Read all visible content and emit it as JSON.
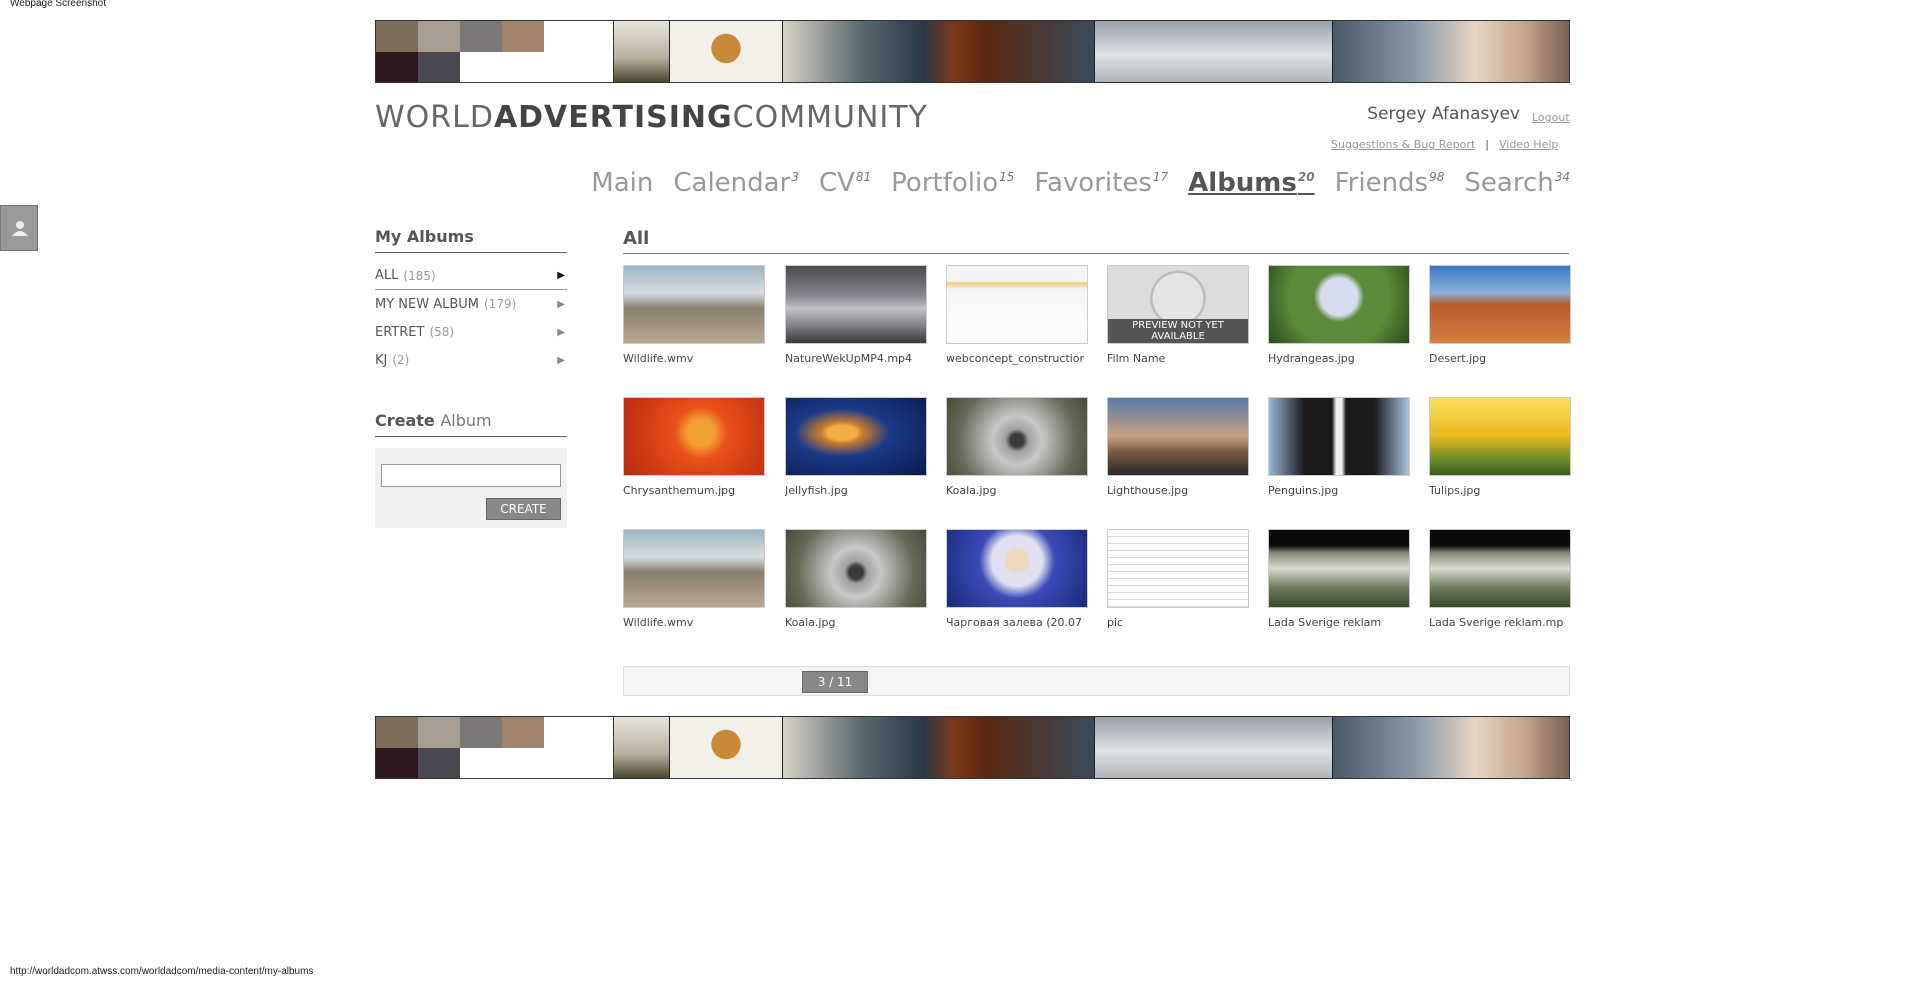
{
  "screenshot_caption": "Webpage Screenshot",
  "status_url": "http://worldadcom.atwss.com/worldadcom/media-content/my-albums",
  "logo": {
    "part1": "WORLD",
    "part2": "ADVERTISING",
    "part3": "COMMUNITY"
  },
  "user": {
    "name": "Sergey Afanasyev",
    "logout": "Logout"
  },
  "help": {
    "suggestions": "Suggestions & Bug Report",
    "separator": "|",
    "video_help": "Video Help"
  },
  "nav": [
    {
      "label": "Main",
      "count": ""
    },
    {
      "label": "Calendar",
      "count": "3"
    },
    {
      "label": "CV",
      "count": "81"
    },
    {
      "label": "Portfolio",
      "count": "15"
    },
    {
      "label": "Favorites",
      "count": "17"
    },
    {
      "label": "Albums",
      "count": "20"
    },
    {
      "label": "Friends",
      "count": "98"
    },
    {
      "label": "Search",
      "count": "34"
    }
  ],
  "sidebar": {
    "my_albums_title": "My Albums",
    "albums": [
      {
        "name": "ALL",
        "count": "(185)"
      },
      {
        "name": "MY NEW ALBUM",
        "count": "(179)"
      },
      {
        "name": "ERTRET",
        "count": "(58)"
      },
      {
        "name": "KJ",
        "count": "(2)"
      }
    ],
    "create_title_bold": "Create",
    "create_title_light": "Album",
    "create_input_value": "",
    "create_button": "CREATE"
  },
  "main": {
    "title": "All",
    "preview_label": "PREVIEW NOT YET AVAILABLE",
    "items": [
      {
        "caption": "Wildlife.wmv",
        "thumb": "beach-horses"
      },
      {
        "caption": "NatureWekUpMP4.mp4",
        "thumb": "cloudy-lake"
      },
      {
        "caption": "webconcept_constructior",
        "thumb": "web-page"
      },
      {
        "caption": "Film Name",
        "thumb": "film-countdown"
      },
      {
        "caption": "Hydrangeas.jpg",
        "thumb": "hydrangeas"
      },
      {
        "caption": "Desert.jpg",
        "thumb": "desert"
      },
      {
        "caption": "Chrysanthemum.jpg",
        "thumb": "chrysanthemum"
      },
      {
        "caption": "Jellyfish.jpg",
        "thumb": "jellyfish"
      },
      {
        "caption": "Koala.jpg",
        "thumb": "koala"
      },
      {
        "caption": "Lighthouse.jpg",
        "thumb": "lighthouse"
      },
      {
        "caption": "Penguins.jpg",
        "thumb": "penguins"
      },
      {
        "caption": "Tulips.jpg",
        "thumb": "tulips"
      },
      {
        "caption": "Wildlife.wmv",
        "thumb": "beach-horses"
      },
      {
        "caption": "Koala.jpg",
        "thumb": "koala"
      },
      {
        "caption": "Чарговая залева (20.07",
        "thumb": "news-presenter"
      },
      {
        "caption": "pic",
        "thumb": "document"
      },
      {
        "caption": "Lada Sverige reklam",
        "thumb": "car-garage"
      },
      {
        "caption": "Lada Sverige reklam.mp",
        "thumb": "car-garage"
      }
    ]
  },
  "pager": {
    "label": "3 / 11"
  },
  "colors": {
    "accent": "#888888",
    "text": "#555555",
    "swatches": [
      "#7a6d58",
      "#a89d92",
      "#7b7877",
      "#a38670",
      "#2d1820",
      "#4a4850"
    ]
  }
}
